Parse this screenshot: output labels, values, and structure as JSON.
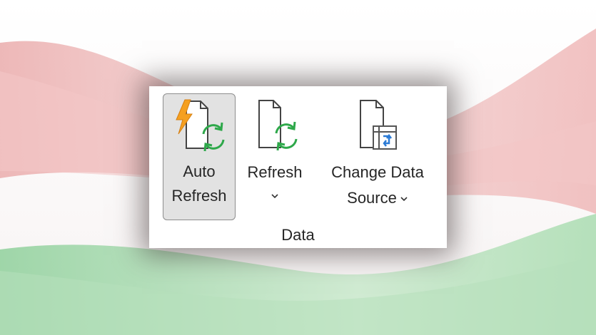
{
  "ribbon": {
    "group_label": "Data",
    "commands": [
      {
        "id": "auto_refresh",
        "line1": "Auto",
        "line2": "Refresh",
        "icon": "auto-refresh-icon",
        "selected": true
      },
      {
        "id": "refresh",
        "line1": "Refresh",
        "icon": "refresh-icon",
        "has_dropdown": true
      },
      {
        "id": "change_data_source",
        "line1": "Change Data",
        "line2": "Source",
        "icon": "change-data-source-icon",
        "has_dropdown": true
      }
    ]
  },
  "colors": {
    "lightning": "#f5a020",
    "refresh_arrows": "#2ea84a",
    "data_source_accent": "#2b7bd6",
    "selected_bg": "#e2e2e2"
  }
}
